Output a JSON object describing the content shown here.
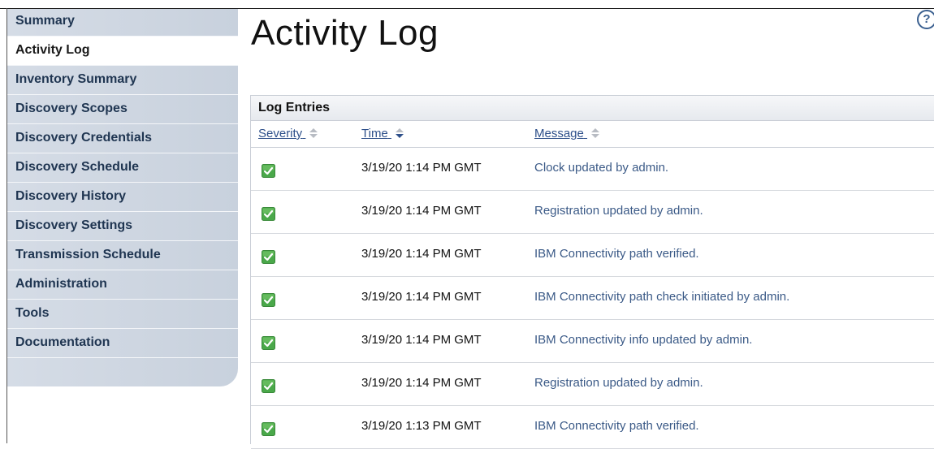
{
  "nav": {
    "items": [
      {
        "label": "Summary",
        "active": false
      },
      {
        "label": "Activity Log",
        "active": true
      },
      {
        "label": "Inventory Summary",
        "active": false
      },
      {
        "label": "Discovery Scopes",
        "active": false
      },
      {
        "label": "Discovery Credentials",
        "active": false
      },
      {
        "label": "Discovery Schedule",
        "active": false
      },
      {
        "label": "Discovery History",
        "active": false
      },
      {
        "label": "Discovery Settings",
        "active": false
      },
      {
        "label": "Transmission Schedule",
        "active": false
      },
      {
        "label": "Administration",
        "active": false
      },
      {
        "label": "Tools",
        "active": false
      },
      {
        "label": "Documentation",
        "active": false
      }
    ]
  },
  "page": {
    "title": "Activity Log",
    "help_icon": "help-icon"
  },
  "log": {
    "panel_title": "Log Entries",
    "columns": {
      "severity": "Severity",
      "time": "Time",
      "message": "Message"
    },
    "severity_icon": "check-success-icon",
    "success_color": "#4aa84a",
    "entries": [
      {
        "time": "3/19/20 1:14 PM GMT",
        "message": "Clock updated by admin."
      },
      {
        "time": "3/19/20 1:14 PM GMT",
        "message": "Registration updated by admin."
      },
      {
        "time": "3/19/20 1:14 PM GMT",
        "message": "IBM Connectivity path verified."
      },
      {
        "time": "3/19/20 1:14 PM GMT",
        "message": "IBM Connectivity path check initiated by admin."
      },
      {
        "time": "3/19/20 1:14 PM GMT",
        "message": "IBM Connectivity info updated by admin."
      },
      {
        "time": "3/19/20 1:14 PM GMT",
        "message": "Registration updated by admin."
      },
      {
        "time": "3/19/20 1:13 PM GMT",
        "message": "IBM Connectivity path verified."
      }
    ]
  }
}
